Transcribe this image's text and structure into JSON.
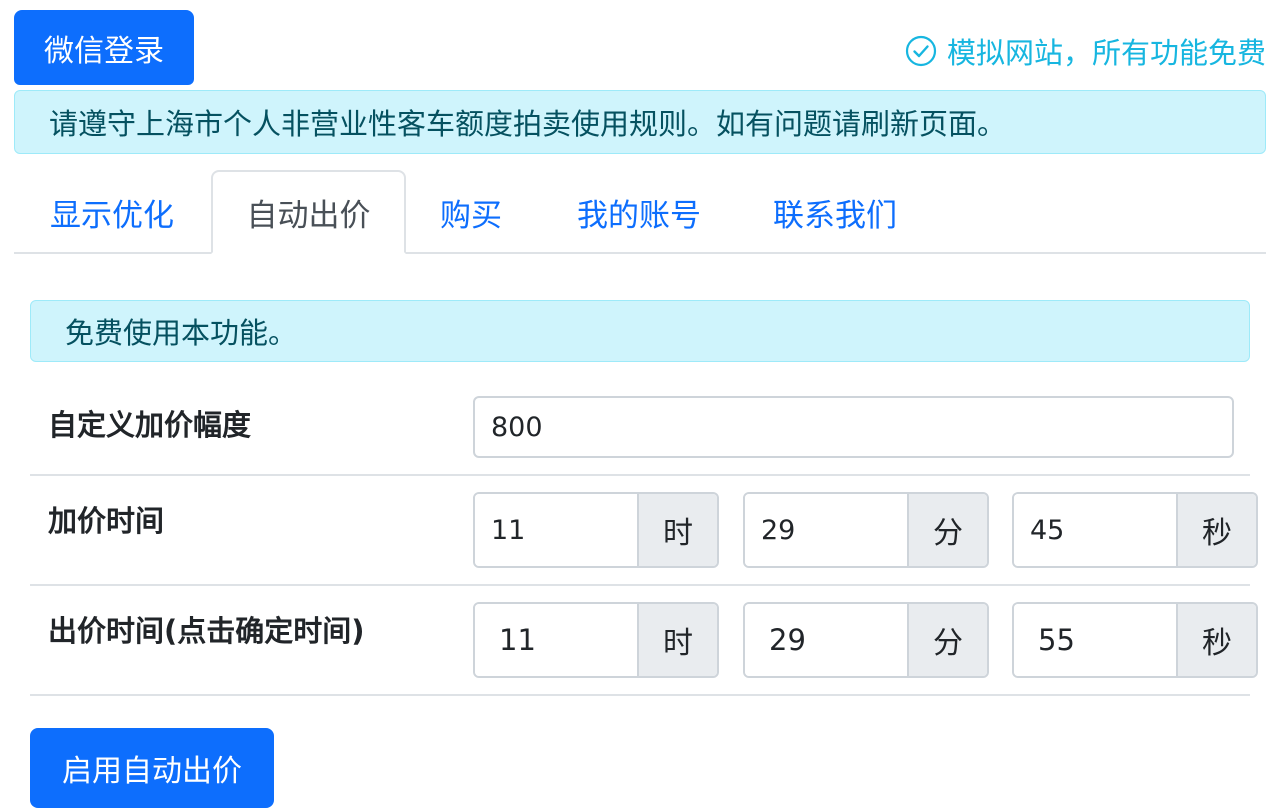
{
  "header": {
    "login_button": "微信登录",
    "notice": "模拟网站，所有功能免费",
    "notice_icon": "check-circle-icon",
    "accent_color": "#17b6e0"
  },
  "rules_alert": "请遵守上海市个人非营业性客车额度拍卖使用规则。如有问题请刷新页面。",
  "tabs": [
    {
      "label": "显示优化",
      "active": false
    },
    {
      "label": "自动出价",
      "active": true
    },
    {
      "label": "购买",
      "active": false
    },
    {
      "label": "我的账号",
      "active": false
    },
    {
      "label": "联系我们",
      "active": false
    }
  ],
  "panel": {
    "free_alert": "免费使用本功能。",
    "custom_increase": {
      "label": "自定义加价幅度",
      "value": "800"
    },
    "increase_time": {
      "label": "加价时间",
      "hour": "11",
      "hour_unit": "时",
      "minute": "29",
      "minute_unit": "分",
      "second": "45",
      "second_unit": "秒"
    },
    "bid_time": {
      "label": "出价时间(点击确定时间)",
      "hour": "11",
      "hour_unit": "时",
      "minute": "29",
      "minute_unit": "分",
      "second": "55",
      "second_unit": "秒"
    },
    "enable_button": "启用自动出价"
  },
  "colors": {
    "primary": "#0d6efd",
    "alert_bg": "#cff4fc",
    "alert_text": "#055160"
  }
}
